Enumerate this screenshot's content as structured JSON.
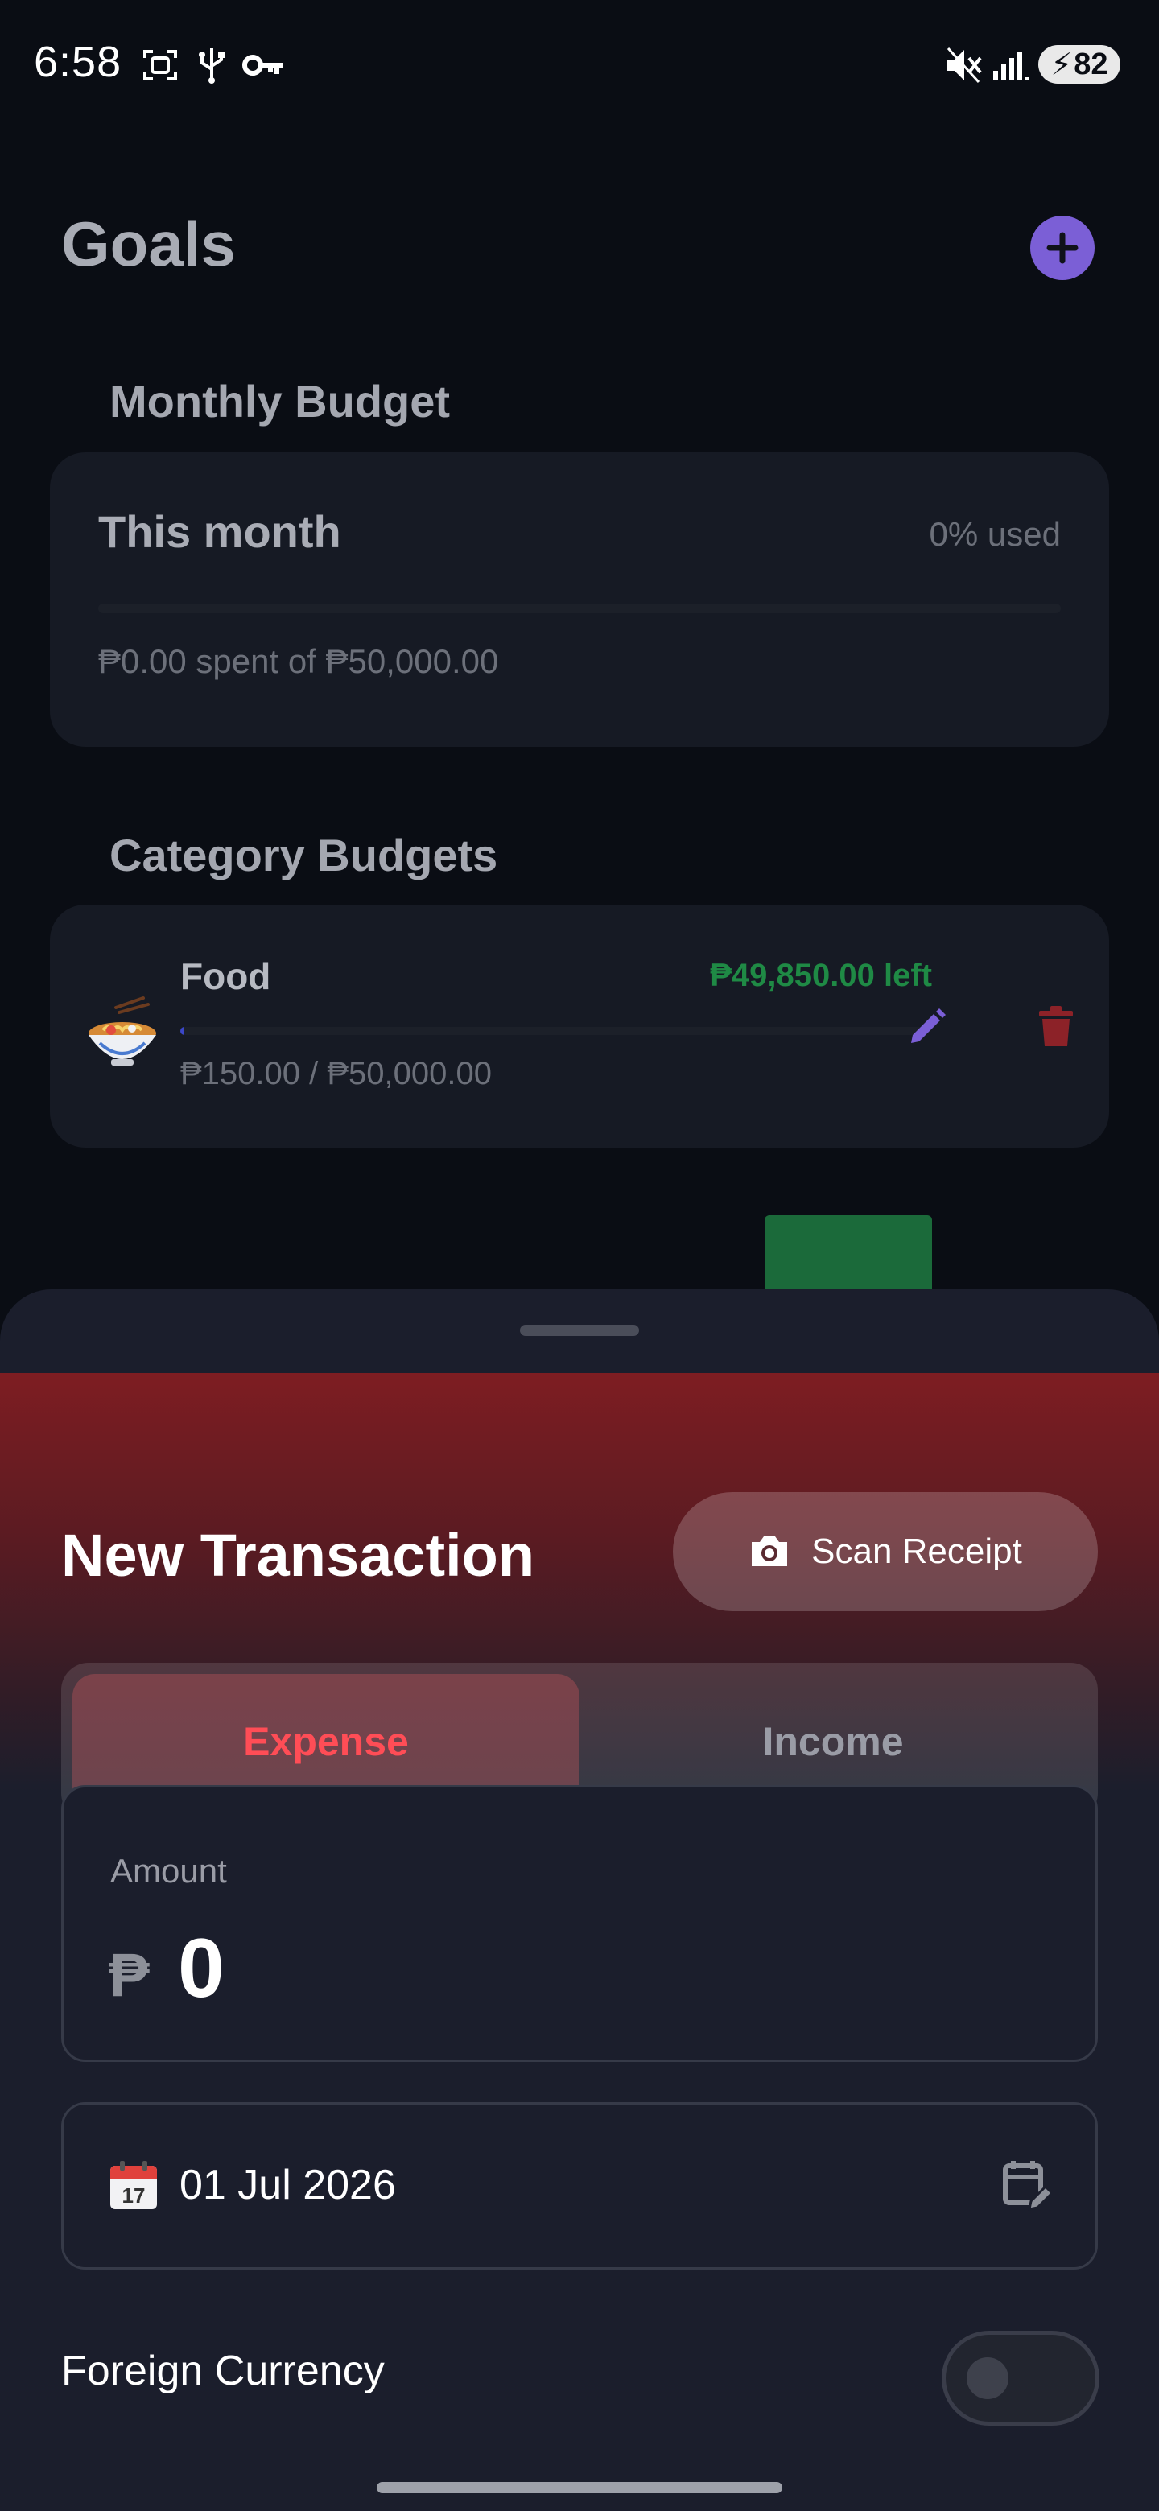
{
  "status_bar": {
    "time": "6:58",
    "battery": "82",
    "icons": [
      "screenshot-icon",
      "usb-icon",
      "vpn-key-icon",
      "mute-icon",
      "signal-icon",
      "battery-charging-icon"
    ]
  },
  "goals_page": {
    "title": "Goals",
    "add_button_icon": "plus-icon",
    "monthly_budget": {
      "section_title": "Monthly Budget",
      "card_title": "This month",
      "used_label": "0% used",
      "used_fraction": 0,
      "spent_text": "₱0.00 spent of ₱50,000.00"
    },
    "category_budgets": {
      "section_title": "Category Budgets",
      "items": [
        {
          "emoji_icon": "noodle-bowl-icon",
          "name": "Food",
          "left_text": "₱49,850.00 left",
          "amount_text": "₱150.00 / ₱50,000.00",
          "used_fraction": 0.003
        }
      ]
    }
  },
  "sheet": {
    "title": "New Transaction",
    "scan_receipt_label": "Scan Receipt",
    "type_options": {
      "expense": "Expense",
      "income": "Income",
      "selected": "expense"
    },
    "amount": {
      "label": "Amount",
      "currency_symbol": "₱",
      "value": "0"
    },
    "date": {
      "value": "01 Jul 2026",
      "calendar_day": "17"
    },
    "foreign_currency": {
      "label": "Foreign Currency",
      "enabled": false
    }
  },
  "colors": {
    "accent": "#7b5fd6",
    "expense": "#ff4d56",
    "positive": "#1f8a45",
    "delete": "#8c2228"
  }
}
